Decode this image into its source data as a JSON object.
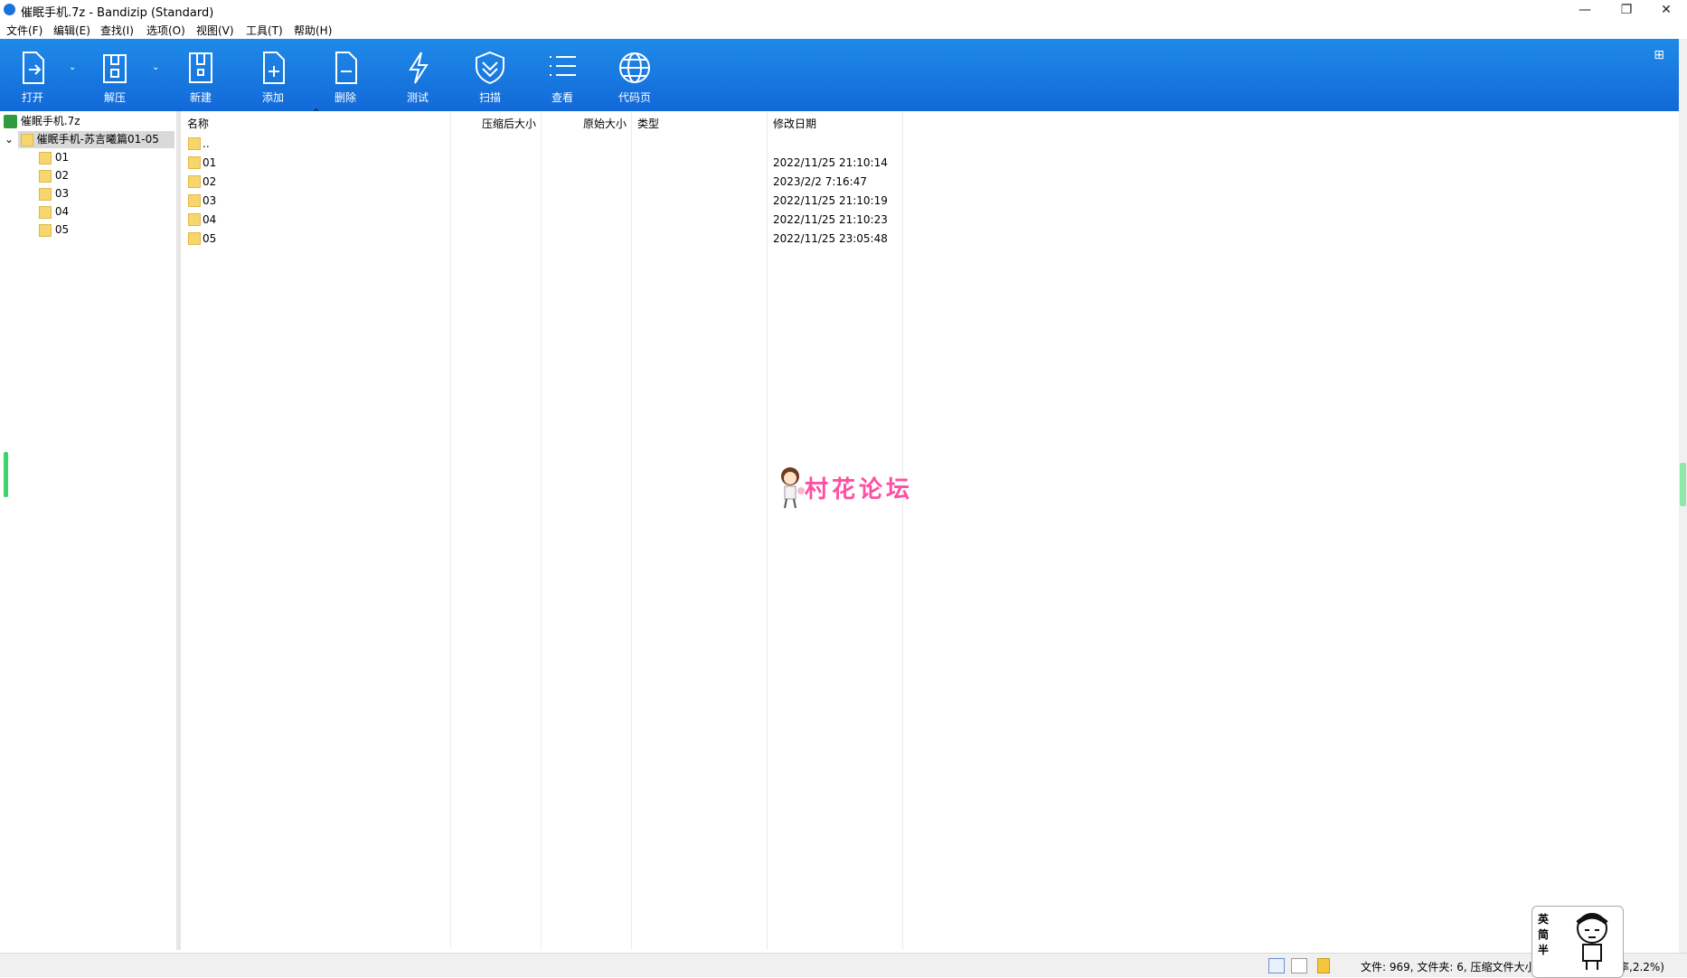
{
  "window": {
    "title": "催眠手机.7z - Bandizip (Standard)",
    "minimize": "—",
    "restore": "❐",
    "close": "✕"
  },
  "menu": [
    "文件(F)",
    "编辑(E)",
    "查找(I)",
    "选项(O)",
    "视图(V)",
    "工具(T)",
    "帮助(H)"
  ],
  "toolbar": {
    "open": "打开",
    "extract": "解压",
    "new": "新建",
    "add": "添加",
    "delete": "删除",
    "test": "测试",
    "scan": "扫描",
    "view": "查看",
    "codepage": "代码页"
  },
  "tree": {
    "root": "催眠手机.7z",
    "selected_folder": "催眠手机-苏言曦篇01-05",
    "children": [
      "01",
      "02",
      "03",
      "04",
      "05"
    ]
  },
  "columns": {
    "name": "名称",
    "packed_size": "压缩后大小",
    "original_size": "原始大小",
    "type": "类型",
    "modified": "修改日期"
  },
  "rows": [
    {
      "name": "..",
      "modified": ""
    },
    {
      "name": "01",
      "modified": "2022/11/25 21:10:14"
    },
    {
      "name": "02",
      "modified": "2023/2/2 7:16:47"
    },
    {
      "name": "03",
      "modified": "2022/11/25 21:10:19"
    },
    {
      "name": "04",
      "modified": "2022/11/25 21:10:23"
    },
    {
      "name": "05",
      "modified": "2022/11/25 23:05:48"
    }
  ],
  "watermark": "村花论坛",
  "status": {
    "summary": "文件: 969, 文件夹: 6, 压缩文件大小:",
    "tail": "率,2.2%)"
  },
  "mascot": {
    "text": "英简半"
  },
  "colors": {
    "toolbar": "#1a7be0",
    "folder": "#f6d66d",
    "selection": "#d9d9d9",
    "watermark": "#ff4fa3"
  }
}
